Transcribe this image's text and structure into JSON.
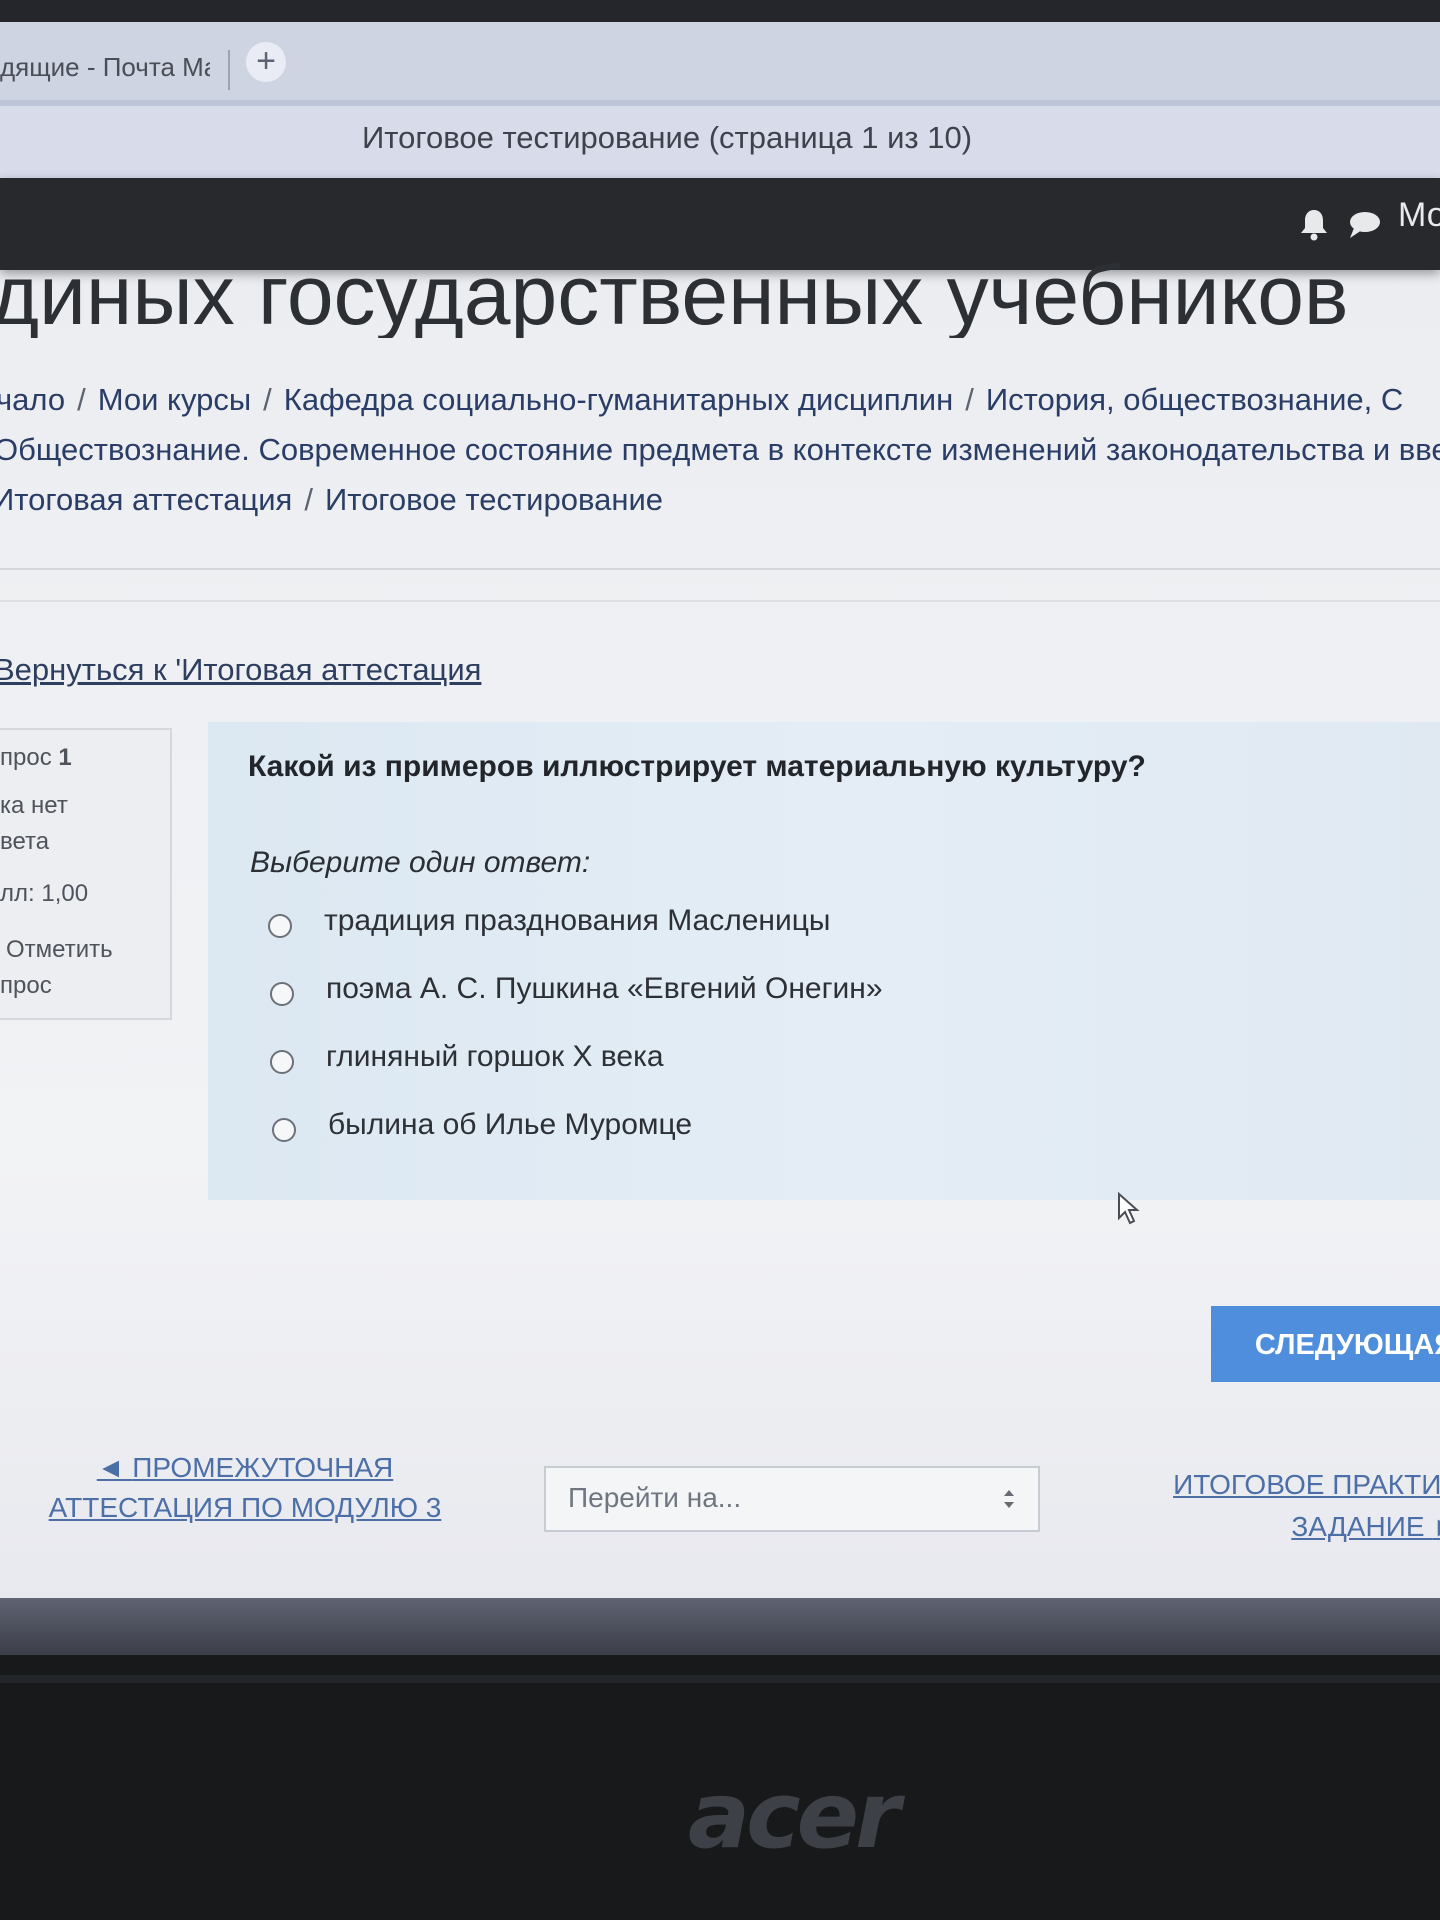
{
  "browser": {
    "tab_title": "дящие - Почта Ma",
    "new_tab_icon": "+",
    "window_title": "Итоговое тестирование (страница 1 из 10)"
  },
  "navbar": {
    "icons": [
      "bell-icon",
      "chat-bubble-icon"
    ],
    "user_label": "Мо"
  },
  "page": {
    "heading": "диных государственных учебников",
    "breadcrumb": {
      "line1": [
        "чало",
        "Мои курсы",
        "Кафедра социально-гуманитарных дисциплин",
        "История, обществознание, С"
      ],
      "line2": "Обществознание. Современное состояние предмета в контексте изменений законодательства и вве",
      "line3": [
        "Итоговая аттестация",
        "Итоговое тестирование"
      ]
    },
    "back_link": "Вернуться к 'Итоговая аттестация"
  },
  "question_info": {
    "number_label": "прос",
    "number": "1",
    "status_line1": "ка нет",
    "status_line2": "вета",
    "points": "лл: 1,00",
    "flag_line1": "Отметить",
    "flag_line2": "прос"
  },
  "question": {
    "text": "Какой из примеров иллюстрирует материальную культуру?",
    "prompt": "Выберите один ответ:",
    "options": [
      "традиция празднования Масленицы",
      "поэма А. С. Пушкина «Евгений Онегин»",
      "глиняный горшок X века",
      "былина об Илье Муромце"
    ]
  },
  "actions": {
    "next_button": "СЛЕДУЮЩАЯ"
  },
  "activity_nav": {
    "prev_arrow": "◄",
    "prev_line1": "ПРОМЕЖУТОЧНАЯ",
    "prev_line2": "АТТЕСТАЦИЯ ПО МОДУЛЮ 3",
    "jump_placeholder": "Перейти на...",
    "next_line1": "ИТОГОВОЕ ПРАКТИЧ",
    "next_line2": "ЗАДАНИЕ",
    "next_arrow": "►"
  },
  "laptop": {
    "brand": "acer"
  }
}
